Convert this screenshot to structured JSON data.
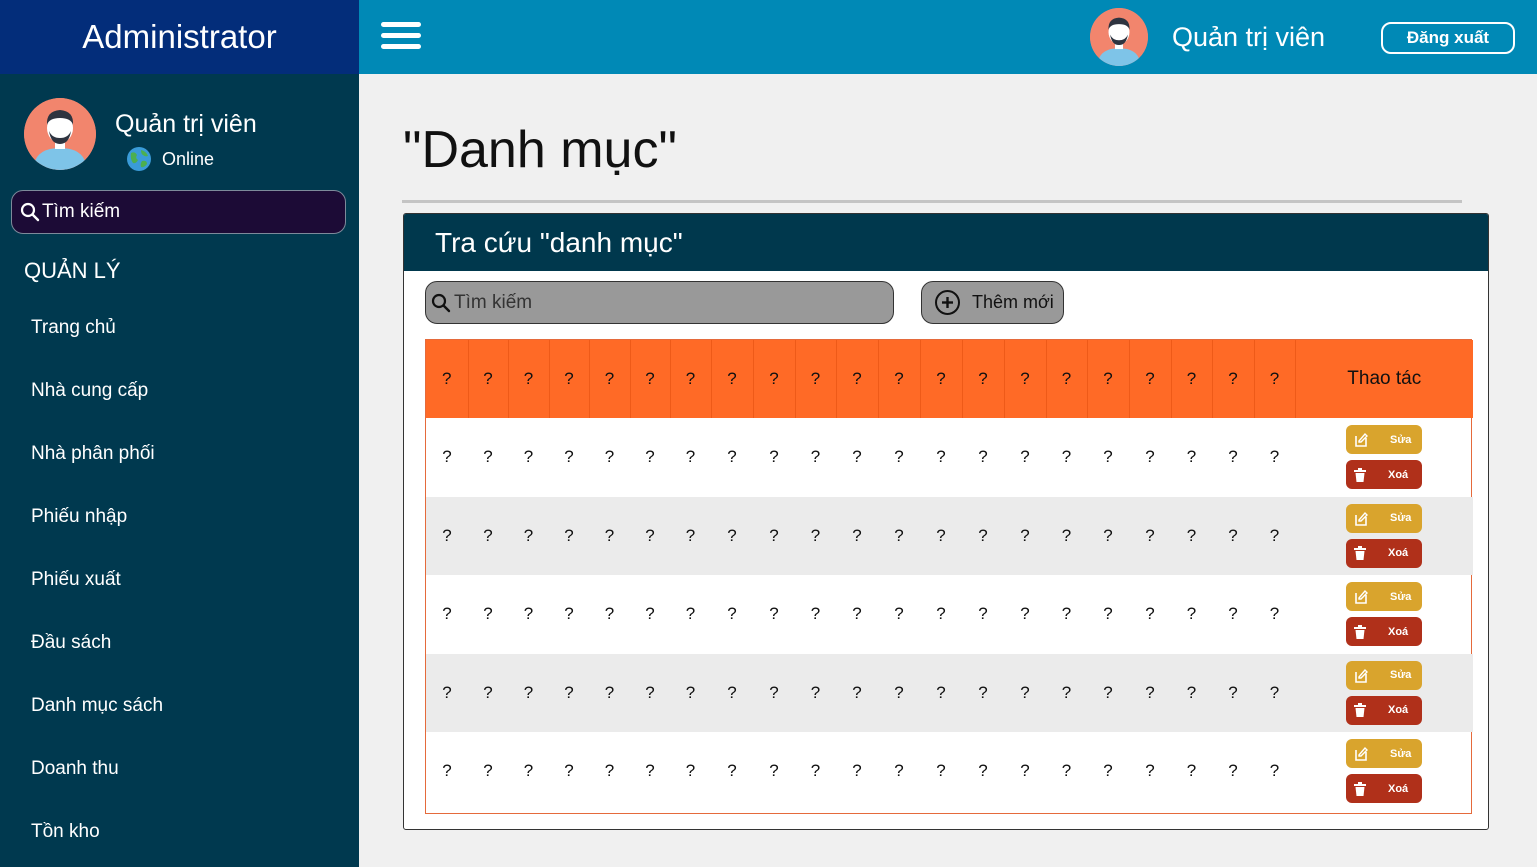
{
  "brand": "Administrator",
  "sidebar": {
    "user_name": "Quản trị viên",
    "status": "Online",
    "search_placeholder": "Tìm kiếm",
    "section_title": "QUẢN LÝ",
    "items": [
      {
        "label": "Trang chủ"
      },
      {
        "label": "Nhà cung cấp"
      },
      {
        "label": "Nhà phân phối"
      },
      {
        "label": "Phiếu nhập"
      },
      {
        "label": "Phiếu xuất"
      },
      {
        "label": "Đầu sách"
      },
      {
        "label": "Danh mục sách"
      },
      {
        "label": "Doanh thu"
      },
      {
        "label": "Tồn kho"
      }
    ]
  },
  "header": {
    "user_name": "Quản trị viên",
    "logout_label": "Đăng xuất"
  },
  "main": {
    "page_title": "\"Danh mục\"",
    "panel_title": "Tra cứu \"danh mục\"",
    "search_placeholder": "Tìm kiếm",
    "add_label": "Thêm mới",
    "table": {
      "columns": [
        "?",
        "?",
        "?",
        "?",
        "?",
        "?",
        "?",
        "?",
        "?",
        "?",
        "?",
        "?",
        "?",
        "?",
        "?",
        "?",
        "?",
        "?",
        "?",
        "?",
        "?"
      ],
      "action_header": "Thao tác",
      "rows": [
        [
          "?",
          "?",
          "?",
          "?",
          "?",
          "?",
          "?",
          "?",
          "?",
          "?",
          "?",
          "?",
          "?",
          "?",
          "?",
          "?",
          "?",
          "?",
          "?",
          "?",
          "?"
        ],
        [
          "?",
          "?",
          "?",
          "?",
          "?",
          "?",
          "?",
          "?",
          "?",
          "?",
          "?",
          "?",
          "?",
          "?",
          "?",
          "?",
          "?",
          "?",
          "?",
          "?",
          "?"
        ],
        [
          "?",
          "?",
          "?",
          "?",
          "?",
          "?",
          "?",
          "?",
          "?",
          "?",
          "?",
          "?",
          "?",
          "?",
          "?",
          "?",
          "?",
          "?",
          "?",
          "?",
          "?"
        ],
        [
          "?",
          "?",
          "?",
          "?",
          "?",
          "?",
          "?",
          "?",
          "?",
          "?",
          "?",
          "?",
          "?",
          "?",
          "?",
          "?",
          "?",
          "?",
          "?",
          "?",
          "?"
        ],
        [
          "?",
          "?",
          "?",
          "?",
          "?",
          "?",
          "?",
          "?",
          "?",
          "?",
          "?",
          "?",
          "?",
          "?",
          "?",
          "?",
          "?",
          "?",
          "?",
          "?",
          "?"
        ]
      ],
      "edit_label": "Sửa",
      "delete_label": "Xoá"
    }
  },
  "colors": {
    "sidebar_bg": "#00394f",
    "brand_bg": "#032d7a",
    "header_bg": "#0089b6",
    "table_header_bg": "#ff6a26",
    "edit_button": "#d9a42d",
    "delete_button": "#b0301a"
  },
  "icons": [
    "menu-icon",
    "search-icon",
    "globe-icon",
    "plus-circle-icon",
    "edit-icon",
    "trash-icon",
    "avatar"
  ]
}
